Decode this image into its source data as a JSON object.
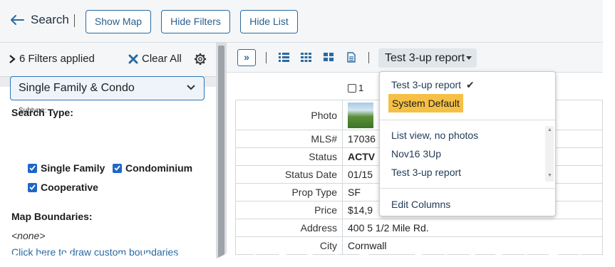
{
  "topbar": {
    "back_label": "Search",
    "buttons": [
      "Show Map",
      "Hide Filters",
      "Hide List"
    ]
  },
  "filters": {
    "applied_label": "6 Filters applied",
    "clear_all_label": "Clear All",
    "search_type_label": "Search Type:",
    "search_type_value": "Single Family & Condo",
    "subtype_label": "Subtype:",
    "subtypes": [
      {
        "label": "Single Family",
        "checked": true
      },
      {
        "label": "Condominium",
        "checked": true
      },
      {
        "label": "Cooperative",
        "checked": true
      }
    ],
    "map_boundaries_label": "Map Boundaries:",
    "map_boundaries_value": "<none>",
    "draw_link_label": "Click here to draw custom boundaries"
  },
  "results_toolbar": {
    "expand_label": "»",
    "report_label": "Test 3-up report"
  },
  "grid": {
    "header_label": "1",
    "rows": [
      {
        "key": "Photo",
        "value": ""
      },
      {
        "key": "MLS#",
        "value": "17036"
      },
      {
        "key": "Status",
        "value": "ACTV"
      },
      {
        "key": "Status Date",
        "value": "01/15"
      },
      {
        "key": "Prop Type",
        "value": "SF"
      },
      {
        "key": "Price",
        "value": "$14,9"
      },
      {
        "key": "Address",
        "value": "400 5 1/2 Mile Rd."
      },
      {
        "key": "City",
        "value": "Cornwall"
      }
    ]
  },
  "report_menu": {
    "current": "Test 3-up report",
    "current_check": "✔",
    "highlighted": "System Default",
    "items": [
      "List view, no photos",
      "Nov16 3Up",
      "Test 3-up report"
    ],
    "edit_columns": "Edit Columns"
  },
  "colors": {
    "accent": "#2b6aa0",
    "highlight": "#f5c045",
    "status_active": "#1f8a1f",
    "checkbox": "#1e67c8"
  }
}
